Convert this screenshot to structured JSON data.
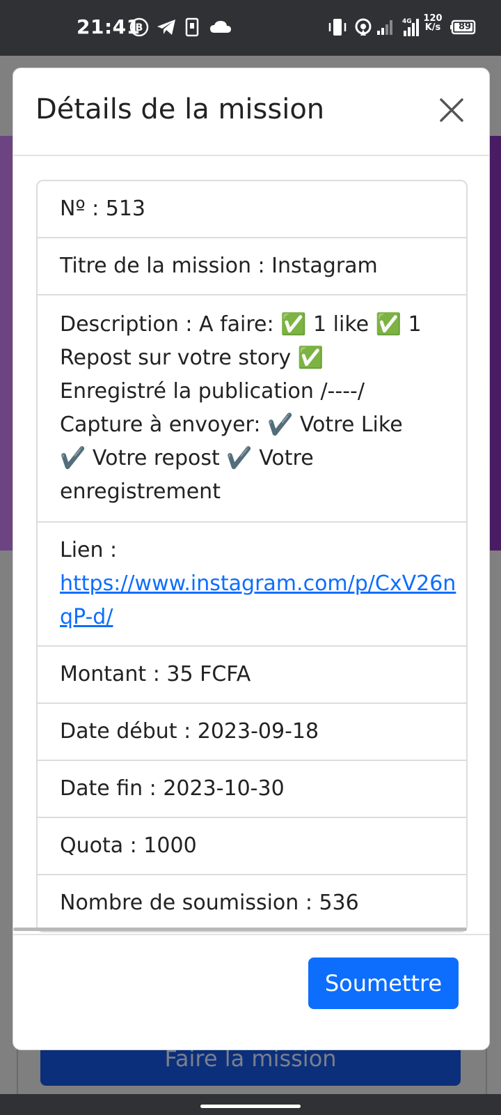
{
  "status_bar": {
    "time": "21:41",
    "network_speed": "120\nK/s",
    "battery": "89",
    "network_type": "4G",
    "icons": [
      "b-circle-icon",
      "telegram-icon",
      "phone-icon",
      "cloud-icon",
      "vibrate-icon",
      "hotspot-icon",
      "signal-icon",
      "signal-icon",
      "battery-icon"
    ]
  },
  "background": {
    "action_button_label": "Faire la mission"
  },
  "modal": {
    "title": "Détails de la mission",
    "rows": [
      {
        "label": "Nº : 513"
      },
      {
        "label": "Titre de la mission : Instagram"
      },
      {
        "label": "Description : A faire: ✅ 1 like ✅ 1 Repost sur votre story ✅ Enregistré la publication /----/ Capture à envoyer: ✔️ Votre Like ✔️ Votre repost ✔️ Votre enregistrement"
      },
      {
        "label": "Lien :",
        "link_line1": "https://www.instagram.com/p/CxV26n",
        "link_line2": "qP-d/"
      },
      {
        "label": "Montant : 35 FCFA"
      },
      {
        "label": "Date début : 2023-09-18"
      },
      {
        "label": "Date fin : 2023-10-30"
      },
      {
        "label": "Quota : 1000"
      },
      {
        "label": "Nombre de soumission : 536"
      }
    ],
    "submit_label": "Soumettre"
  }
}
